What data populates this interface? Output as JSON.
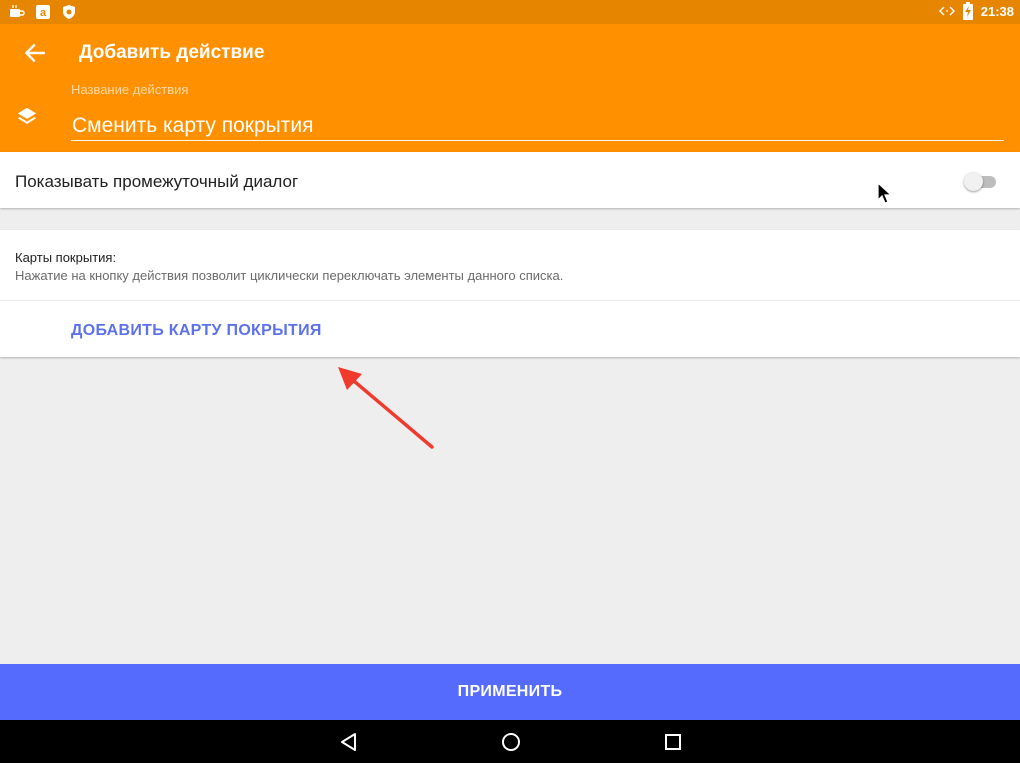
{
  "status_bar": {
    "time": "21:38",
    "left_icons": [
      "coffee-icon",
      "amazon-icon",
      "shield-icon"
    ],
    "right_icons": [
      "code-arrows-icon",
      "battery-charging-icon"
    ]
  },
  "app_bar": {
    "title": "Добавить действие",
    "field_label": "Название действия",
    "field_value": "Сменить карту покрытия",
    "accent_color": "#ff9100"
  },
  "intermediate_dialog": {
    "label": "Показывать промежуточный диалог",
    "enabled": false
  },
  "overlay_maps": {
    "title": "Карты покрытия:",
    "description": "Нажатие на кнопку действия позволит циклически переключать элементы данного списка.",
    "add_button": "ДОБАВИТЬ КАРТУ ПОКРЫТИЯ"
  },
  "apply_button": {
    "label": "ПРИМЕНИТЬ",
    "color": "#546bfd"
  },
  "nav_bar": {
    "buttons": [
      "back-icon",
      "home-icon",
      "recents-icon"
    ]
  }
}
